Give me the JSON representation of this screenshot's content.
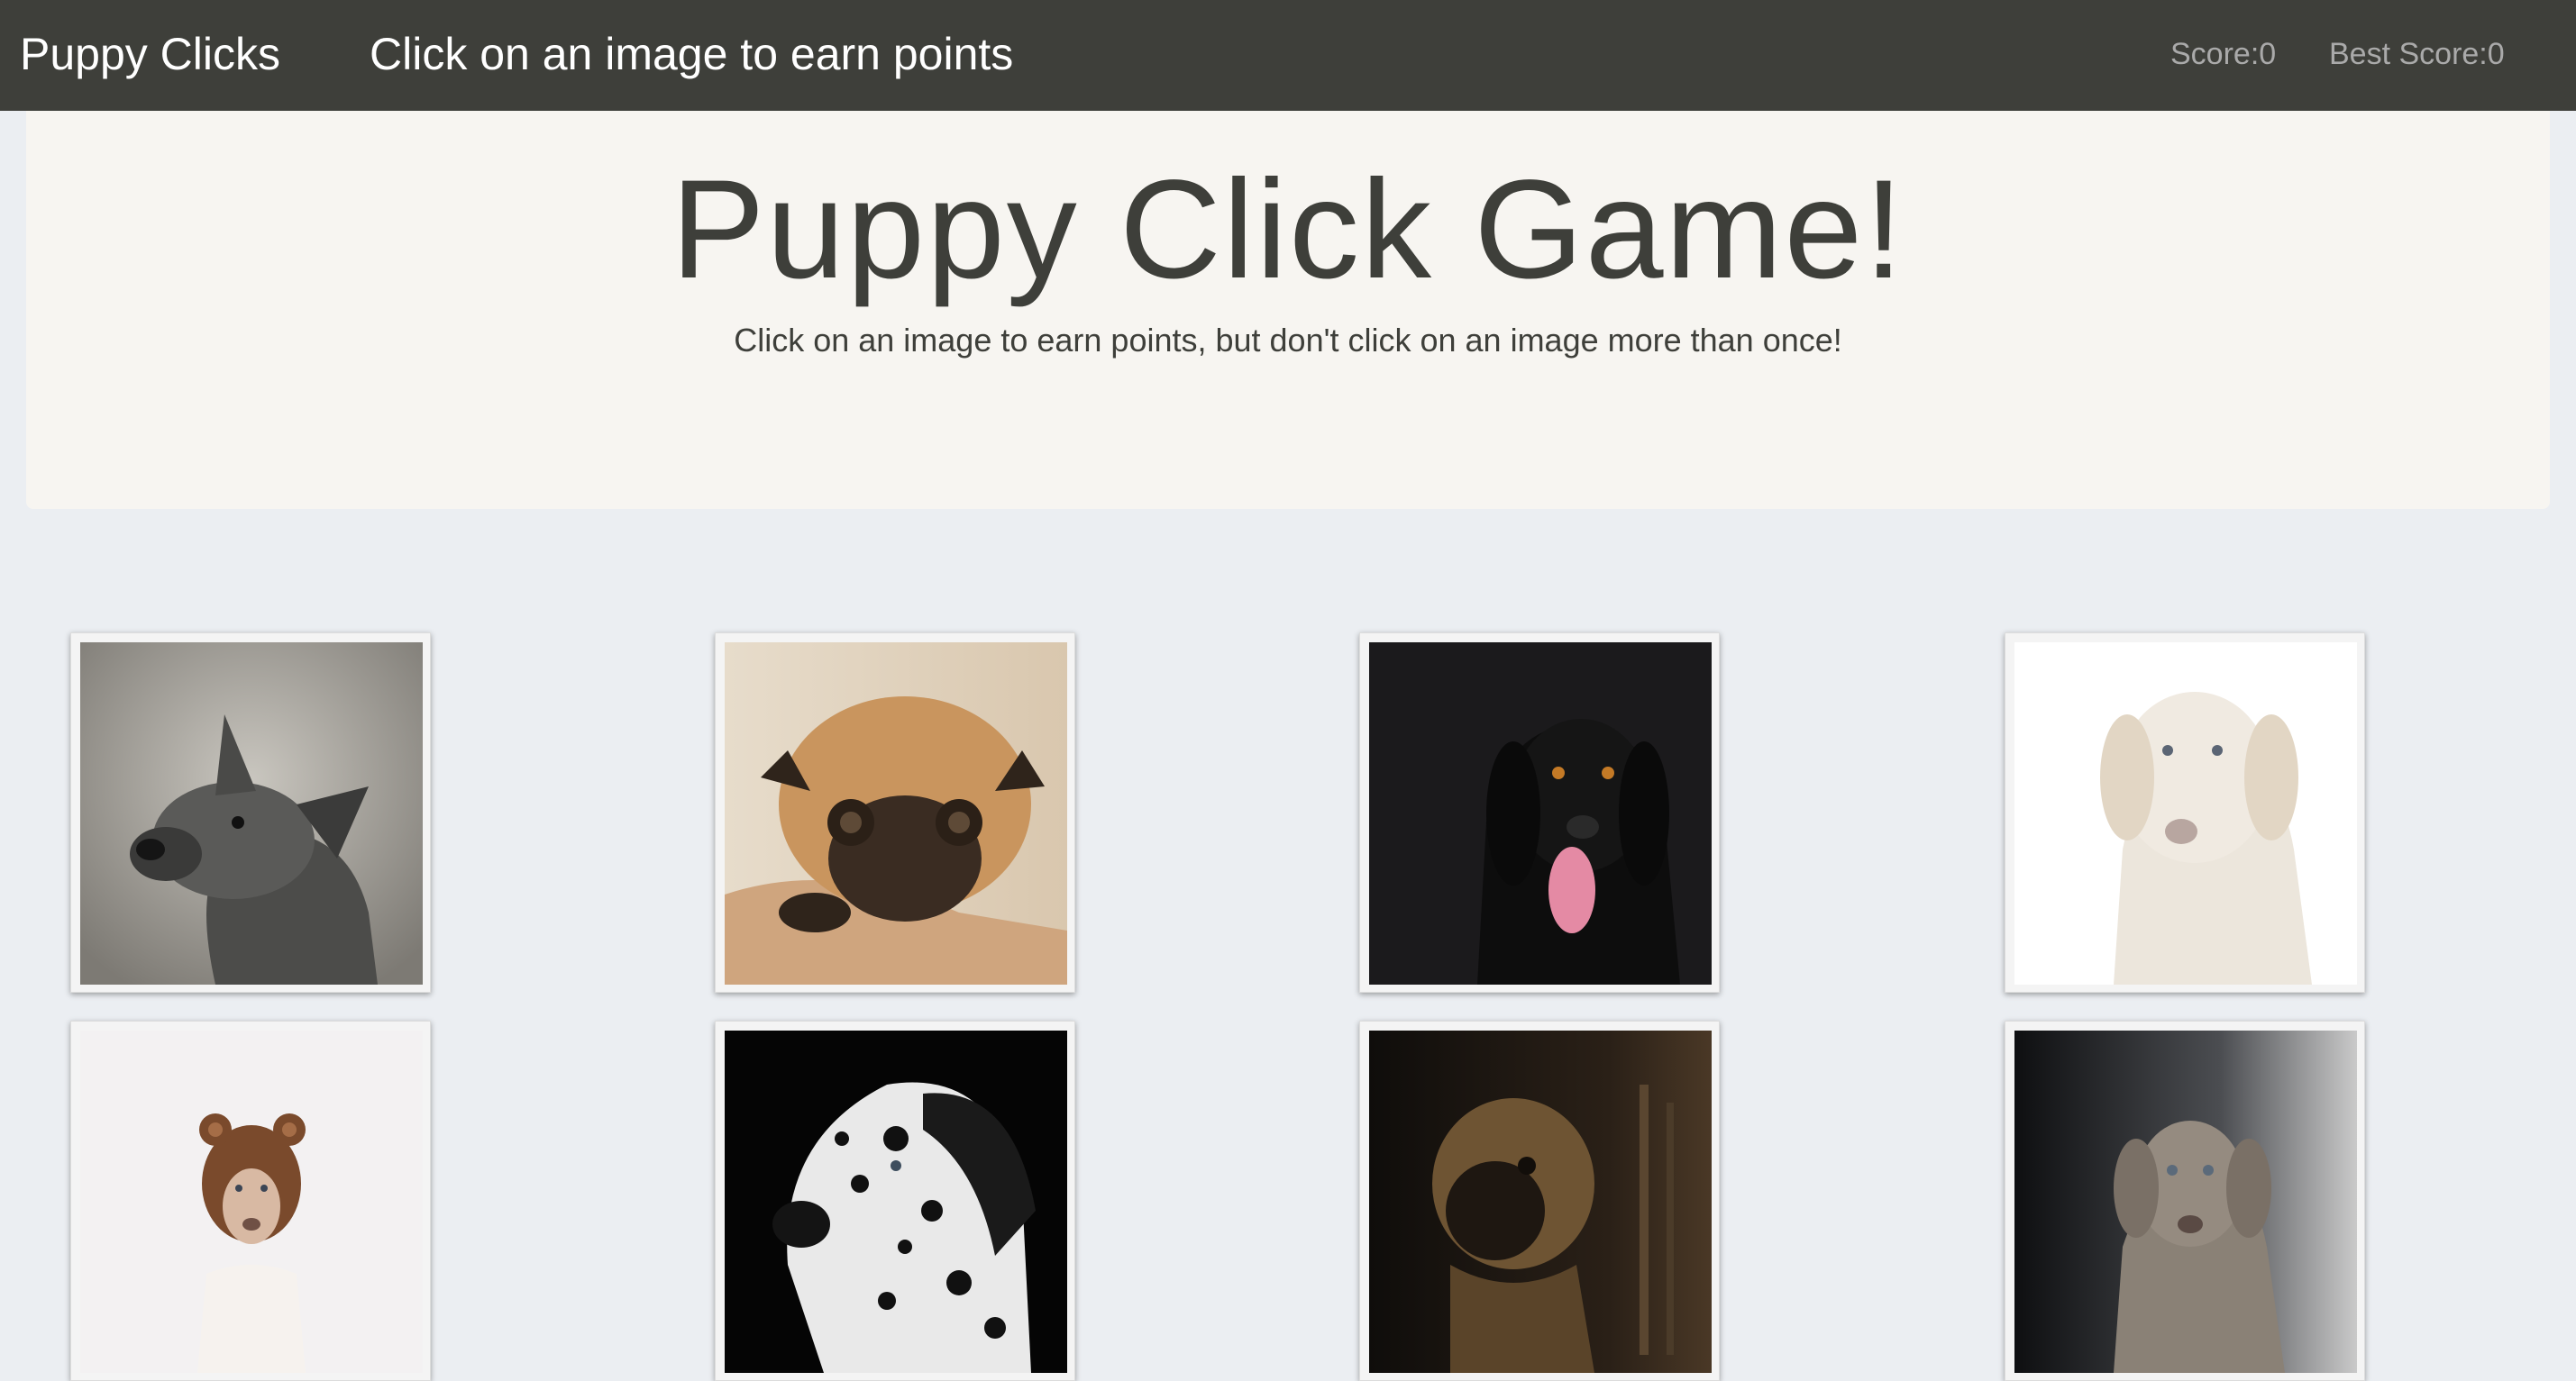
{
  "navbar": {
    "brand": "Puppy Clicks",
    "message": "Click on an image to earn points",
    "score_label": "Score:0",
    "best_score_label": "Best Score:0"
  },
  "jumbotron": {
    "title": "Puppy Click Game!",
    "subtitle": "Click on an image to earn points, but don't click on an image more than once!"
  },
  "colors": {
    "navbar_bg": "#3e3f3a",
    "page_bg": "#ebeef2",
    "jumbotron_bg": "#f7f5f1",
    "text_dark": "#3e3f3a",
    "score_text": "#aaaaaa"
  },
  "cards": [
    {
      "subject": "grey-puppy-photo"
    },
    {
      "subject": "pug-on-couch-photo"
    },
    {
      "subject": "black-dog-tongue-photo"
    },
    {
      "subject": "white-labrador-photo"
    },
    {
      "subject": "dog-in-bear-hat-photo"
    },
    {
      "subject": "dalmatian-photo"
    },
    {
      "subject": "pug-in-dark-photo"
    },
    {
      "subject": "weimaraner-puppy-photo"
    }
  ]
}
